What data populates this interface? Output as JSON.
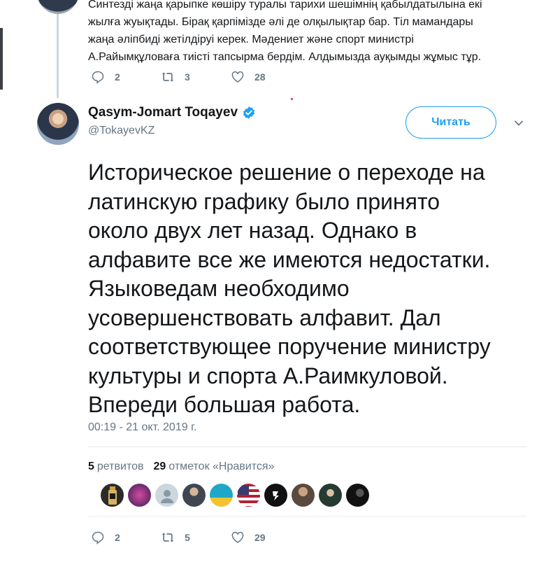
{
  "previous_tweet": {
    "text": "Синтезді жаңа қарыпке көшіру туралы тарихи шешімнің қабылдатылына екі\nжылға жуықтады. Бірақ қарпімізде әлі де олқылықтар бар. Тіл мамандары\nжаңа әліпбиді жетілдіруі керек. Мәдениет және спорт министрі\nА.Райымқұловаға тиісті тапсырма бердім. Алдымызда ауқымды жұмыс тұр.",
    "actions": {
      "replies": "2",
      "retweets": "3",
      "likes": "28"
    }
  },
  "tweet": {
    "author_name": "Qasym-Jomart Toqayev",
    "author_handle": "@TokayevKZ",
    "follow_label": "Читать",
    "text": "Историческое решение о переходе на\nлатинскую графику было принято\nоколо двух лет назад. Однако в\nалфавите все же имеются недостатки.\nЯзыковедам необходимо\nусовершенствовать алфавит. Дал\nсоответствующее поручение министру\nкультуры и спорта А.Раимкуловой.\nВпереди большая работа.",
    "timestamp": "00:19 - 21 окт. 2019 г.",
    "stats": {
      "retweets_count": "5",
      "retweets_label": "ретвитов",
      "likes_count": "29",
      "likes_label": "отметок «Нравится»"
    },
    "actions": {
      "replies": "2",
      "retweets": "5",
      "likes": "29"
    }
  },
  "likers": [
    {
      "icon": "perfume-bottle-avatar",
      "color": "#2b2b2b"
    },
    {
      "icon": "concert-avatar",
      "color": "#6b2f7a"
    },
    {
      "icon": "default-avatar",
      "color": "#9aa3ab"
    },
    {
      "icon": "man-avatar",
      "color": "#4a4f55"
    },
    {
      "icon": "flag-avatar",
      "color": "#1fa7c9"
    },
    {
      "icon": "us-flag-avatar",
      "color": "#3a5ea8"
    },
    {
      "icon": "logo-avatar",
      "color": "#111111"
    },
    {
      "icon": "man-avatar",
      "color": "#6f5d50"
    },
    {
      "icon": "man-avatar",
      "color": "#2f4a3e"
    },
    {
      "icon": "dark-avatar",
      "color": "#1a1a1a"
    }
  ],
  "colors": {
    "accent": "#1da1f2",
    "muted": "#657786",
    "separator": "#e6ecf0"
  }
}
